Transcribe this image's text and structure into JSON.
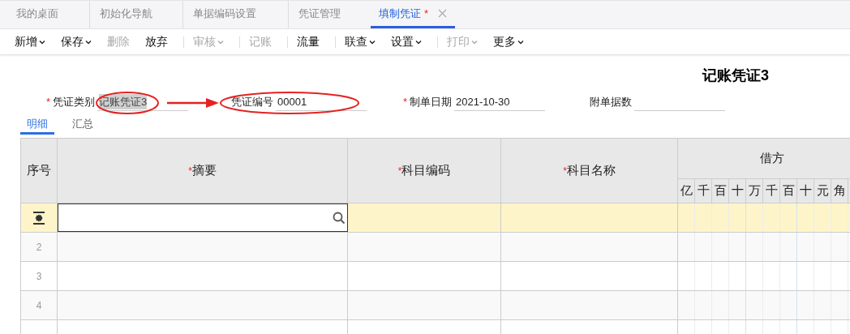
{
  "tabs": [
    {
      "label": "我的桌面",
      "selected": false,
      "closable": false
    },
    {
      "label": "初始化导航",
      "selected": false,
      "closable": false
    },
    {
      "label": "单据编码设置",
      "selected": false,
      "closable": false
    },
    {
      "label": "凭证管理",
      "selected": false,
      "closable": false
    },
    {
      "label": "填制凭证",
      "selected": true,
      "modified_mark": "*",
      "closable": true
    }
  ],
  "toolbar_groups": [
    [
      {
        "label": "新增",
        "dropdown": true,
        "disabled": false
      },
      {
        "label": "保存",
        "dropdown": true,
        "disabled": false
      },
      {
        "label": "删除",
        "dropdown": false,
        "disabled": true
      },
      {
        "label": "放弃",
        "dropdown": false,
        "disabled": false
      }
    ],
    [
      {
        "label": "审核",
        "dropdown": true,
        "disabled": true
      }
    ],
    [
      {
        "label": "记账",
        "dropdown": false,
        "disabled": true
      }
    ],
    [
      {
        "label": "流量",
        "dropdown": false,
        "disabled": false
      }
    ],
    [
      {
        "label": "联查",
        "dropdown": true,
        "disabled": false
      },
      {
        "label": "设置",
        "dropdown": true,
        "disabled": false
      }
    ],
    [
      {
        "label": "打印",
        "dropdown": true,
        "disabled": true
      },
      {
        "label": "更多",
        "dropdown": true,
        "disabled": false
      }
    ]
  ],
  "voucher_title": "记账凭证3",
  "fields": [
    {
      "required_mark": "*",
      "label": "凭证类别",
      "value": "记账凭证3",
      "highlighted": true
    },
    {
      "label": "凭证编号",
      "value": "00001",
      "highlighted": false
    },
    {
      "required_mark": "*",
      "label": "制单日期",
      "value": "2021-10-30",
      "highlighted": false
    },
    {
      "label": "附单据数",
      "highlighted": false
    }
  ],
  "subtabs": [
    {
      "label": "明细",
      "selected": true
    },
    {
      "label": "汇总",
      "selected": false
    }
  ],
  "table": {
    "columns": [
      {
        "label": "序号"
      },
      {
        "required_mark": "*",
        "label": "摘要"
      },
      {
        "required_mark": "*",
        "label": "科目编码"
      },
      {
        "required_mark": "*",
        "label": "科目名称"
      }
    ],
    "debit": {
      "label": "借方",
      "digits": [
        "亿",
        "千",
        "百",
        "十",
        "万",
        "千",
        "百",
        "十",
        "元",
        "角"
      ]
    },
    "rows": [
      {
        "kind": "active"
      },
      {
        "kind": "numbered",
        "number": "2"
      },
      {
        "kind": "numbered",
        "number": "3"
      },
      {
        "kind": "numbered",
        "number": "4"
      },
      {
        "kind": "numbered"
      }
    ]
  }
}
